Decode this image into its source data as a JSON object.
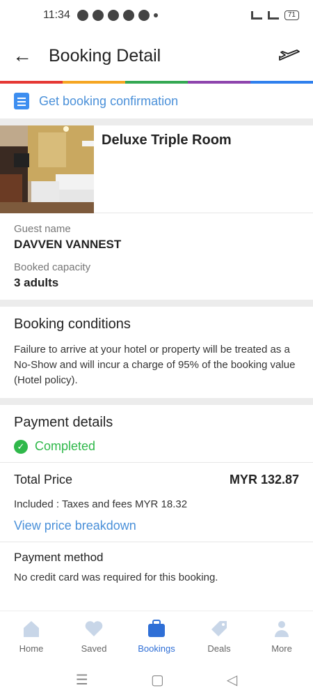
{
  "statusbar": {
    "time": "11:34",
    "battery": "71"
  },
  "appbar": {
    "title": "Booking Detail",
    "back_icon": "back-arrow-icon",
    "plane_icon": "plane-icon"
  },
  "rainbow_colors": [
    "#e53935",
    "#f5a623",
    "#34a853",
    "#8e44ad",
    "#2f80ed"
  ],
  "confirmation": {
    "label": "Get booking confirmation"
  },
  "room": {
    "name": "Deluxe Triple Room"
  },
  "guest": {
    "name_label": "Guest name",
    "name": "DAVVEN VANNEST",
    "capacity_label": "Booked capacity",
    "capacity": "3 adults"
  },
  "conditions": {
    "title": "Booking conditions",
    "text": "Failure to arrive at your hotel or property will be treated as a No-Show and will incur a charge of 95% of the booking value (Hotel policy)."
  },
  "payment": {
    "title": "Payment details",
    "status": "Completed",
    "total_label": "Total Price",
    "total_value": "MYR 132.87",
    "included": "Included : Taxes and fees MYR 18.32",
    "breakdown_link": "View price breakdown",
    "method_title": "Payment method",
    "method_text": "No credit card was required for this booking."
  },
  "nav": [
    {
      "label": "Home",
      "icon": "home-icon"
    },
    {
      "label": "Saved",
      "icon": "heart-icon"
    },
    {
      "label": "Bookings",
      "icon": "briefcase-icon"
    },
    {
      "label": "Deals",
      "icon": "tag-icon"
    },
    {
      "label": "More",
      "icon": "person-icon"
    }
  ]
}
